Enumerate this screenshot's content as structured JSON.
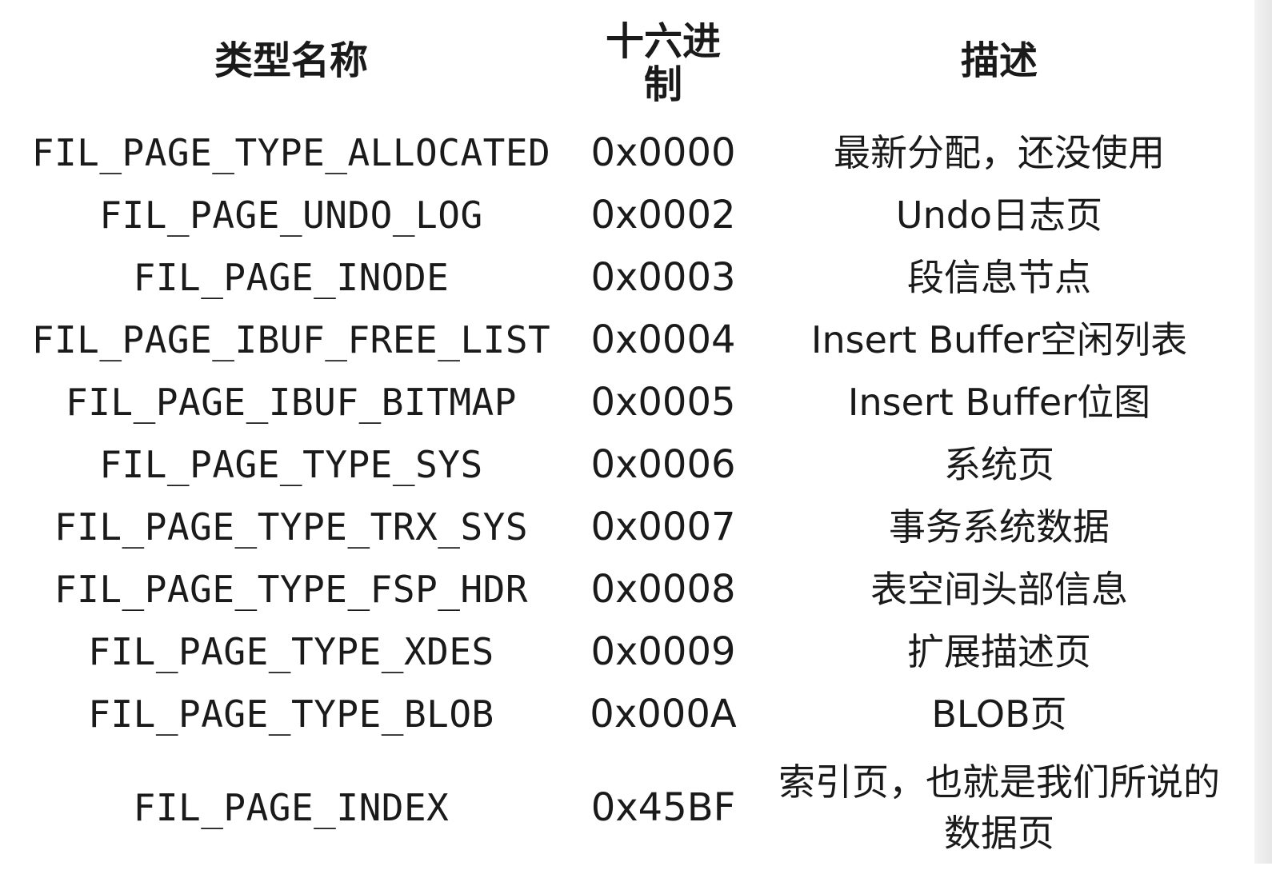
{
  "header": {
    "type_name": "类型名称",
    "hex_line1": "十六进",
    "hex_line2": "制",
    "description": "描述"
  },
  "rows": [
    {
      "name": "FIL_PAGE_TYPE_ALLOCATED",
      "hex": "0x0000",
      "desc": "最新分配，还没使用"
    },
    {
      "name": "FIL_PAGE_UNDO_LOG",
      "hex": "0x0002",
      "desc": "Undo日志页"
    },
    {
      "name": "FIL_PAGE_INODE",
      "hex": "0x0003",
      "desc": "段信息节点"
    },
    {
      "name": "FIL_PAGE_IBUF_FREE_LIST",
      "hex": "0x0004",
      "desc": "Insert Buffer空闲列表"
    },
    {
      "name": "FIL_PAGE_IBUF_BITMAP",
      "hex": "0x0005",
      "desc": "Insert Buffer位图"
    },
    {
      "name": "FIL_PAGE_TYPE_SYS",
      "hex": "0x0006",
      "desc": "系统页"
    },
    {
      "name": "FIL_PAGE_TYPE_TRX_SYS",
      "hex": "0x0007",
      "desc": "事务系统数据"
    },
    {
      "name": "FIL_PAGE_TYPE_FSP_HDR",
      "hex": "0x0008",
      "desc": "表空间头部信息"
    },
    {
      "name": "FIL_PAGE_TYPE_XDES",
      "hex": "0x0009",
      "desc": "扩展描述页"
    },
    {
      "name": "FIL_PAGE_TYPE_BLOB",
      "hex": "0x000A",
      "desc": "BLOB页"
    },
    {
      "name": "FIL_PAGE_INDEX",
      "hex": "0x45BF",
      "desc": "索引页，也就是我们所说的",
      "desc2": "数据页"
    }
  ]
}
